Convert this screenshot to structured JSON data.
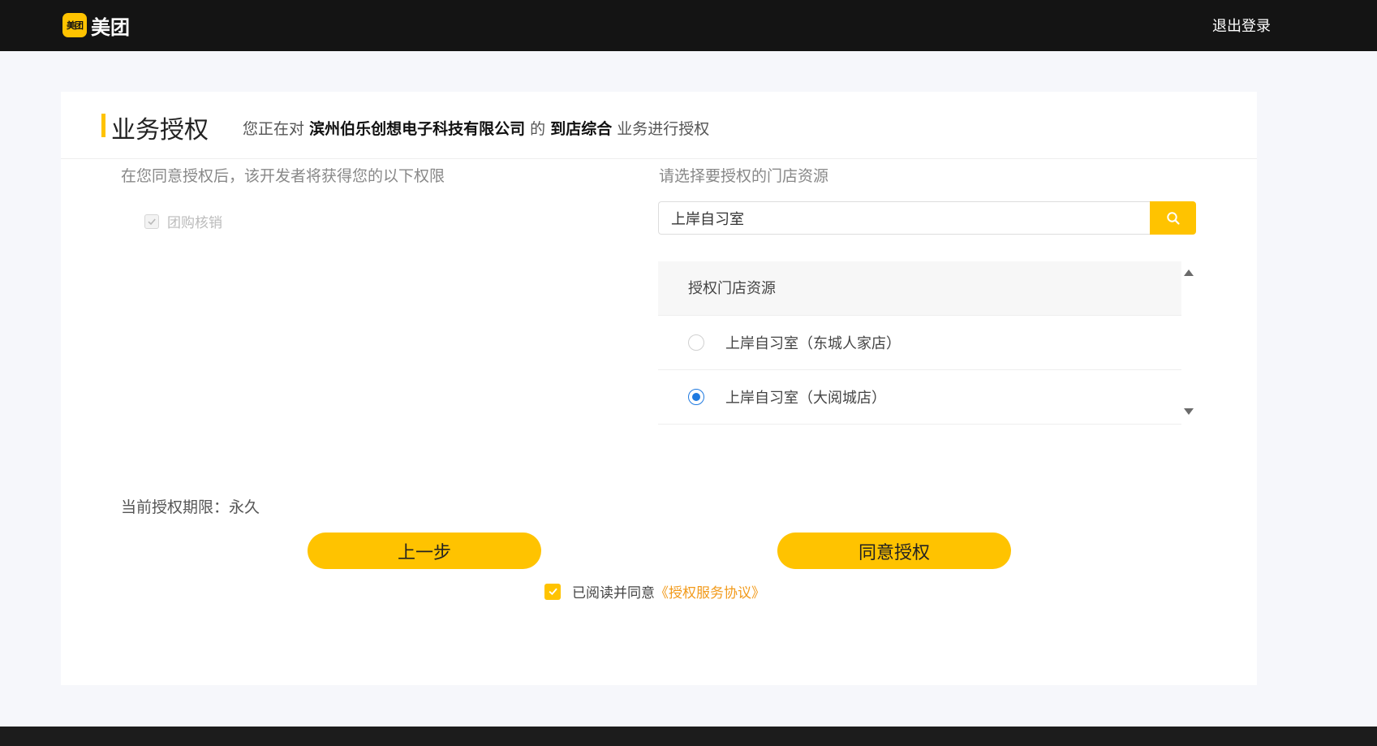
{
  "header": {
    "logo_badge": "美团",
    "logo_text": "美团",
    "logout_label": "退出登录"
  },
  "card": {
    "title": "业务授权",
    "subtitle_pre": "您正在对",
    "company": "滨州伯乐创想电子科技有限公司",
    "subtitle_mid": "的",
    "business": "到店综合",
    "subtitle_post": "业务进行授权"
  },
  "permissions": {
    "intro": "在您同意授权后，该开发者将获得您的以下权限",
    "items": [
      {
        "label": "团购核销",
        "checked": true,
        "disabled": true
      }
    ]
  },
  "store_select": {
    "intro": "请选择要授权的门店资源",
    "search_value": "上岸自习室",
    "list_header": "授权门店资源",
    "stores": [
      {
        "label": "上岸自习室（东城人家店）",
        "selected": false
      },
      {
        "label": "上岸自习室（大阅城店）",
        "selected": true
      }
    ]
  },
  "footer": {
    "period_text": "当前授权期限：永久",
    "prev_label": "上一步",
    "agree_label": "同意授权",
    "agreement_prefix": "已阅读并同意",
    "agreement_link": "《授权服务协议》",
    "agreement_checked": true
  },
  "colors": {
    "accent": "#ffc300",
    "topbar": "#141414",
    "radio_selected": "#1f7ae0",
    "link": "#f29a1a"
  }
}
